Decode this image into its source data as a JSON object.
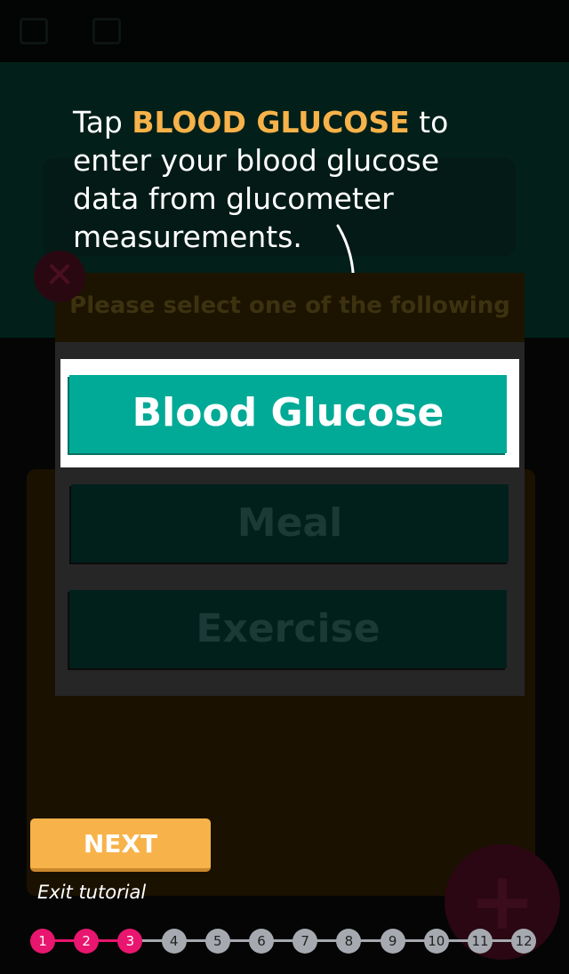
{
  "tutorial": {
    "text_before": "Tap ",
    "highlight": "BLOOD GLUCOSE",
    "text_after": " to enter your blood glucose data from glucometer measurements.",
    "highlight_color": "#f7b24a"
  },
  "dialog": {
    "title": "Please select one of the following",
    "close_icon": "close-icon",
    "options": [
      {
        "label": "Blood Glucose",
        "color": "#00aa96"
      },
      {
        "label": "Meal"
      },
      {
        "label": "Exercise"
      }
    ]
  },
  "footer": {
    "next_label": "NEXT",
    "exit_label": "Exit tutorial",
    "current_step": 3,
    "steps": [
      "1",
      "2",
      "3",
      "4",
      "5",
      "6",
      "7",
      "8",
      "9",
      "10",
      "11",
      "12"
    ],
    "active_color": "#e8166e"
  }
}
